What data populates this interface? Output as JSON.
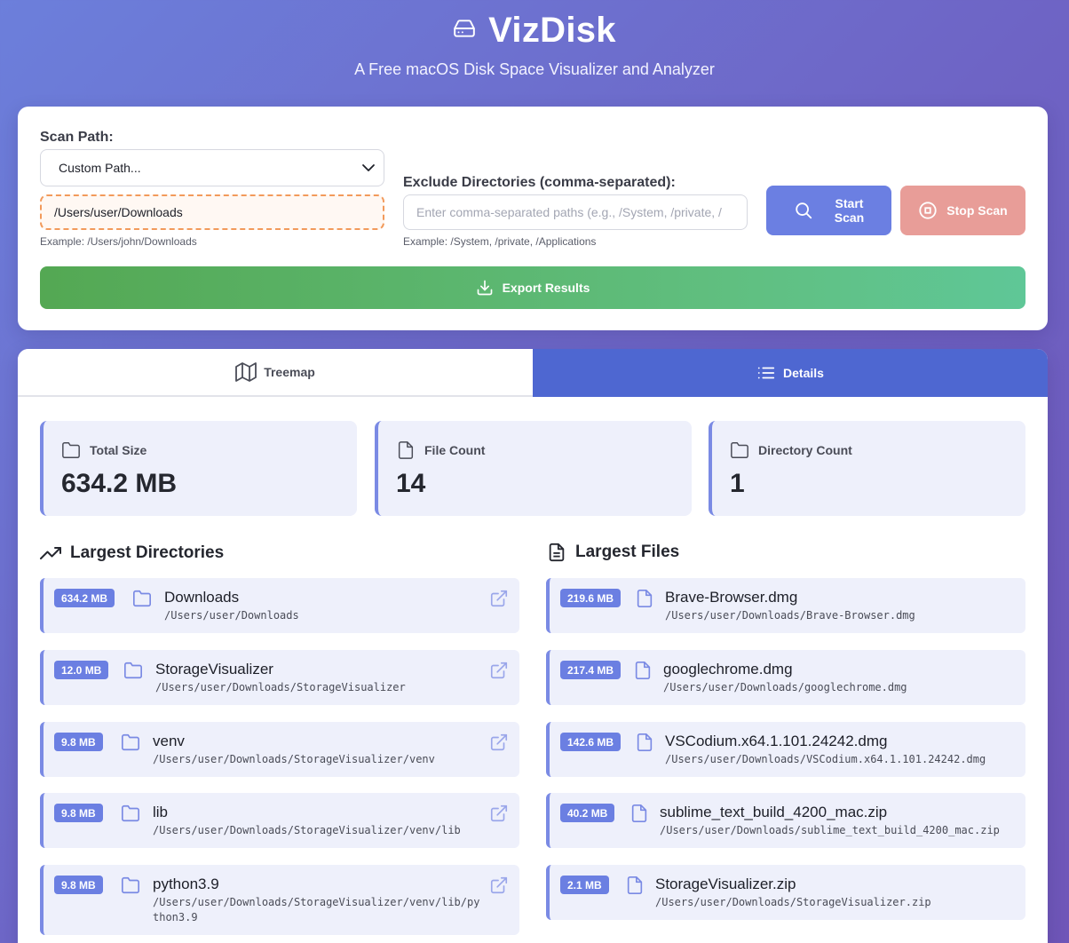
{
  "app": {
    "title": "VizDisk",
    "subtitle": "A Free macOS Disk Space Visualizer and Analyzer"
  },
  "controls": {
    "scan_path_label": "Scan Path:",
    "scan_path_select": "Custom Path...",
    "custom_path_value": "/Users/user/Downloads",
    "scan_path_hint": "Example: /Users/john/Downloads",
    "exclude_label": "Exclude Directories (comma-separated):",
    "exclude_placeholder": "Enter comma-separated paths (e.g., /System, /private, /",
    "exclude_hint": "Example: /System, /private, /Applications",
    "start_label_1": "Start",
    "start_label_2": "Scan",
    "stop_label": "Stop Scan",
    "export_label": "Export Results"
  },
  "tabs": {
    "treemap": "Treemap",
    "details": "Details",
    "active": "details"
  },
  "stats": {
    "total_size_label": "Total Size",
    "total_size_value": "634.2 MB",
    "file_count_label": "File Count",
    "file_count_value": "14",
    "dir_count_label": "Directory Count",
    "dir_count_value": "1"
  },
  "largest_directories": {
    "title": "Largest Directories",
    "items": [
      {
        "size": "634.2 MB",
        "name": "Downloads",
        "path": "/Users/user/Downloads"
      },
      {
        "size": "12.0 MB",
        "name": "StorageVisualizer",
        "path": "/Users/user/Downloads/StorageVisualizer"
      },
      {
        "size": "9.8 MB",
        "name": "venv",
        "path": "/Users/user/Downloads/StorageVisualizer/venv"
      },
      {
        "size": "9.8 MB",
        "name": "lib",
        "path": "/Users/user/Downloads/StorageVisualizer/venv/lib"
      },
      {
        "size": "9.8 MB",
        "name": "python3.9",
        "path_line1": "/Users/user/Downloads/StorageVisualizer/venv/lib/py",
        "path_line2": "thon3.9"
      }
    ]
  },
  "largest_files": {
    "title": "Largest Files",
    "items": [
      {
        "size": "219.6 MB",
        "name": "Brave-Browser.dmg",
        "path": "/Users/user/Downloads/Brave-Browser.dmg"
      },
      {
        "size": "217.4 MB",
        "name": "googlechrome.dmg",
        "path": "/Users/user/Downloads/googlechrome.dmg"
      },
      {
        "size": "142.6 MB",
        "name": "VSCodium.x64.1.101.24242.dmg",
        "path": "/Users/user/Downloads/VSCodium.x64.1.101.24242.dmg"
      },
      {
        "size": "40.2 MB",
        "name": "sublime_text_build_4200_mac.zip",
        "path": "/Users/user/Downloads/sublime_text_build_4200_mac.zip"
      },
      {
        "size": "2.1 MB",
        "name": "StorageVisualizer.zip",
        "path": "/Users/user/Downloads/StorageVisualizer.zip"
      }
    ]
  },
  "colors": {
    "accent": "#6b7fe2",
    "active_tab": "#4e67d1",
    "stop": "#e89d98",
    "export_start": "#54a853",
    "export_end": "#5fc797"
  },
  "icons": {
    "logo": "hard-drive-icon",
    "start": "search-icon",
    "stop": "stop-circle-icon",
    "export": "download-icon",
    "treemap": "map-icon",
    "details": "list-icon",
    "total_size": "folder-icon",
    "file_count": "file-icon",
    "dir_count": "folder-icon",
    "dirs_section": "trending-up-icon",
    "files_section": "file-text-icon",
    "open": "external-link-icon"
  }
}
